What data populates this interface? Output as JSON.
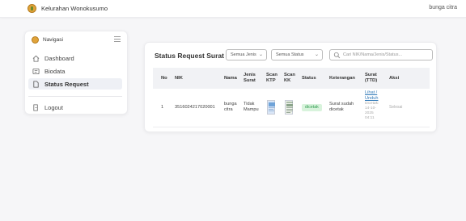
{
  "header": {
    "brand": "Kelurahan Wonokusumo",
    "user": "bunga citra"
  },
  "sidebar": {
    "title": "Navigasi",
    "items": [
      {
        "label": "Dashboard",
        "icon": "home-icon"
      },
      {
        "label": "Biodata",
        "icon": "id-card-icon"
      },
      {
        "label": "Status Request",
        "icon": "document-icon",
        "active": true
      }
    ],
    "logout": "Logout"
  },
  "main": {
    "title": "Status Request Surat",
    "filter_jenis": "Semua Jenis",
    "filter_status": "Semua Status",
    "search_placeholder": "Cari NIK/Nama/Jenis/Status..."
  },
  "table": {
    "headers": {
      "no": "No",
      "nik": "NIK",
      "nama": "Nama",
      "jenis_1": "Jenis",
      "jenis_2": "Surat",
      "ktp_1": "Scan",
      "ktp_2": "KTP",
      "kk_1": "Scan",
      "kk_2": "KK",
      "status": "Status",
      "keterangan": "Keterangan",
      "ttd_1": "Surat",
      "ttd_2": "(TTD)",
      "aksi": "Aksi"
    },
    "rows": [
      {
        "no": "1",
        "nik": "3516024217020001",
        "nama_1": "bunga",
        "nama_2": "citra",
        "jenis_1": "Tidak",
        "jenis_2": "Mampu",
        "status": "dicetak",
        "ket_1": "Surat sudah",
        "ket_2": "dicetak",
        "link_1": "Lihat /",
        "link_2": "Unduh",
        "date_1": "Dicetak:",
        "date_2": "14-10-",
        "date_3": "2025",
        "date_4": "04:11",
        "aksi": "Selesai"
      }
    ]
  },
  "colors": {
    "brand_logo": "#e0a33a",
    "status_badge_bg": "#d8f3dc",
    "status_badge_text": "#2e9b4e",
    "link": "#2f78b7"
  }
}
